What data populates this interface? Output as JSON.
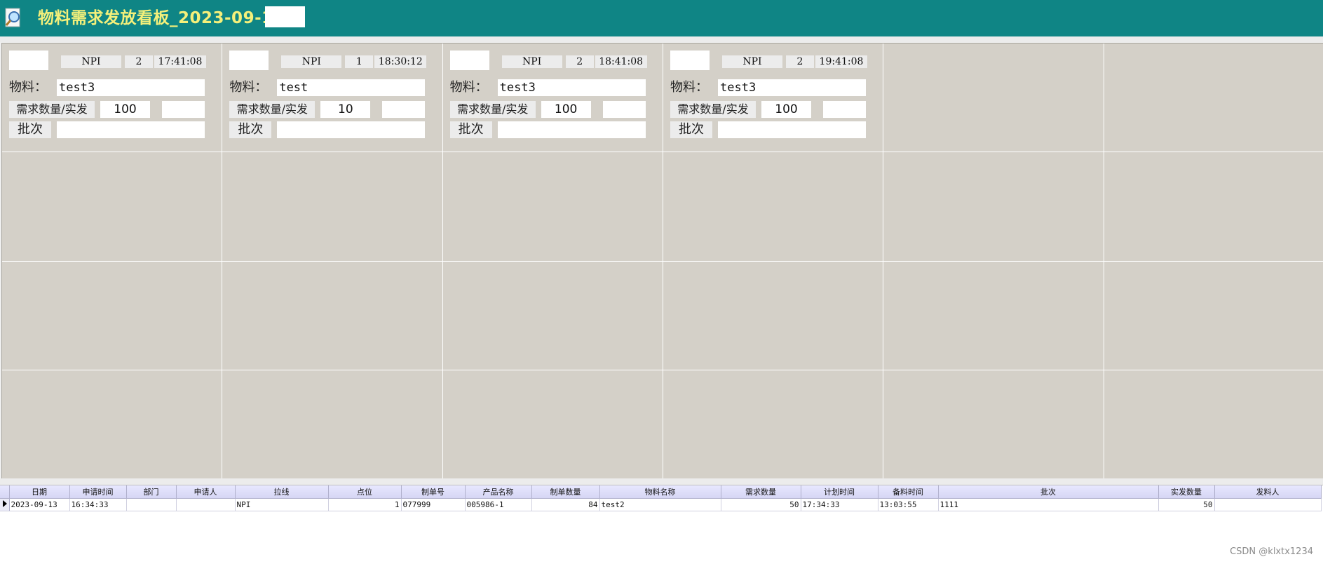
{
  "window": {
    "title": "物料需求发放看板_2023-09-14"
  },
  "labels": {
    "material": "物料：",
    "req_qty": "需求数量/实发",
    "batch": "批次"
  },
  "cards": [
    {
      "line": "NPI",
      "seq": "2",
      "time": "17:41:08",
      "material": "test3",
      "req_qty": "100"
    },
    {
      "line": "NPI",
      "seq": "1",
      "time": "18:30:12",
      "material": "test",
      "req_qty": "10"
    },
    {
      "line": "NPI",
      "seq": "2",
      "time": "18:41:08",
      "material": "test3",
      "req_qty": "100"
    },
    {
      "line": "NPI",
      "seq": "2",
      "time": "19:41:08",
      "material": "test3",
      "req_qty": "100"
    }
  ],
  "table": {
    "columns": [
      "日期",
      "申请时间",
      "部门",
      "申请人",
      "拉线",
      "点位",
      "制单号",
      "产品名称",
      "制单数量",
      "物料名称",
      "需求数量",
      "计划时间",
      "备料时间",
      "批次",
      "实发数量",
      "发料人"
    ],
    "rows": [
      [
        "2023-09-13",
        "16:34:33",
        "",
        "",
        "NPI",
        "1",
        "077999",
        "005986-1",
        "84",
        "test2",
        "50",
        "17:34:33",
        "13:03:55",
        "1111",
        "50",
        ""
      ]
    ]
  },
  "watermark": "CSDN @klxtx1234"
}
